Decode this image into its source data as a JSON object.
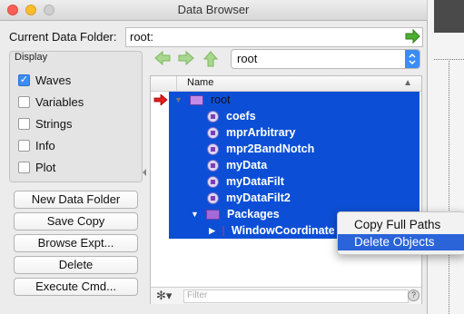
{
  "window": {
    "title": "Data Browser"
  },
  "current_data_folder": {
    "label": "Current Data Folder:",
    "value": "root:"
  },
  "display": {
    "label": "Display",
    "options": [
      {
        "label": "Waves",
        "checked": true
      },
      {
        "label": "Variables",
        "checked": false
      },
      {
        "label": "Strings",
        "checked": false
      },
      {
        "label": "Info",
        "checked": false
      },
      {
        "label": "Plot",
        "checked": false
      }
    ]
  },
  "buttons": {
    "new_data_folder": "New Data Folder",
    "save_copy": "Save Copy",
    "browse_expt": "Browse Expt...",
    "delete": "Delete",
    "execute_cmd": "Execute Cmd..."
  },
  "folder_select": {
    "value": "root"
  },
  "tree": {
    "header": "Name",
    "root": "root",
    "items": [
      "coefs",
      "mprArbitrary",
      "mpr2BandNotch",
      "myData",
      "myDataFilt",
      "myDataFilt2"
    ],
    "packages": "Packages",
    "package_child": "WindowCoordinates"
  },
  "filter": {
    "placeholder": "Filter"
  },
  "context_menu": {
    "items": [
      {
        "label": "Copy Full Paths",
        "highlighted": false
      },
      {
        "label": "Delete Objects",
        "highlighted": true
      }
    ]
  },
  "colors": {
    "selection": "#0c4fd6",
    "menu_highlight": "#2b63d9",
    "nav_arrow": "#4caf2f"
  }
}
